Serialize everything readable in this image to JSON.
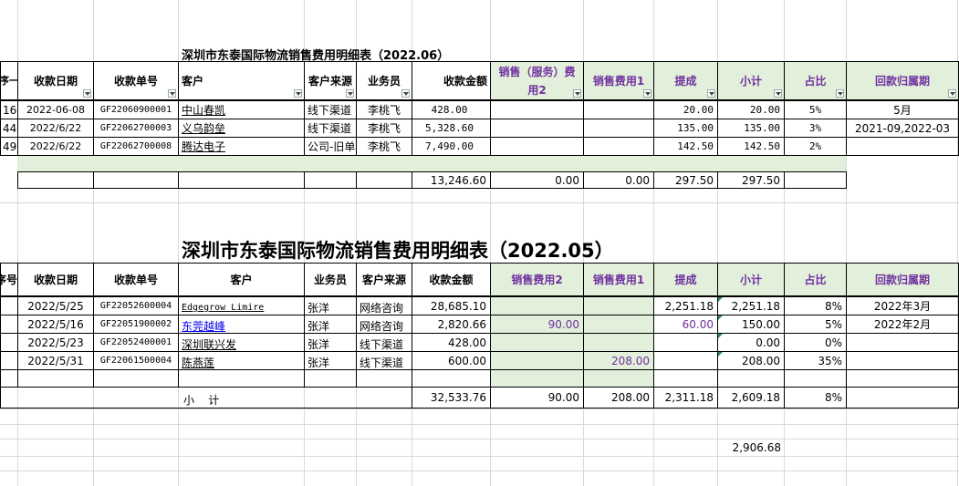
{
  "sheet1": {
    "title": "深圳市东泰国际物流销售费用明细表（2022.06）",
    "headers": {
      "seq": "序一",
      "date": "收款日期",
      "no": "收款单号",
      "customer": "客户",
      "source": "客户来源",
      "salesman": "业务员",
      "amount": "收款金额",
      "fee2_line1": "销售（服务）费",
      "fee2_line2": "用2",
      "fee1": "销售费用1",
      "commission": "提成",
      "subtotal": "小计",
      "ratio": "占比",
      "period": "回款归属期"
    },
    "rows": [
      {
        "seq": "16",
        "date": "2022-06-08",
        "no": "GF22060900001",
        "customer": "中山春凯",
        "source": "线下渠道",
        "salesman": "李桃飞",
        "amount": "428.00",
        "fee2": "",
        "fee1": "",
        "commission": "20.00",
        "subtotal": "20.00",
        "ratio": "5%",
        "period": "5月"
      },
      {
        "seq": "44",
        "date": "2022/6/22",
        "no": "GF22062700003",
        "customer": "义乌韵垒",
        "source": "线下渠道",
        "salesman": "李桃飞",
        "amount": "5,328.60",
        "fee2": "",
        "fee1": "",
        "commission": "135.00",
        "subtotal": "135.00",
        "ratio": "3%",
        "period": "2021-09,2022-03"
      },
      {
        "seq": "49",
        "date": "2022/6/22",
        "no": "GF22062700008",
        "customer": "腾达电子",
        "source": "公司-旧单",
        "salesman": "李桃飞",
        "amount": "7,490.00",
        "fee2": "",
        "fee1": "",
        "commission": "142.50",
        "subtotal": "142.50",
        "ratio": "2%",
        "period": ""
      }
    ],
    "totals": {
      "amount": "13,246.60",
      "fee2": "0.00",
      "fee1": "0.00",
      "commission": "297.50",
      "subtotal": "297.50"
    }
  },
  "sheet2": {
    "title": "深圳市东泰国际物流销售费用明细表（2022.05）",
    "headers": {
      "seq": "序号",
      "date": "收款日期",
      "no": "收款单号",
      "customer": "客户",
      "salesman": "业务员",
      "source": "客户来源",
      "amount": "收款金额",
      "fee2": "销售费用2",
      "fee1": "销售费用1",
      "commission": "提成",
      "subtotal": "小计",
      "ratio": "占比",
      "period": "回款归属期"
    },
    "rows": [
      {
        "date": "2022/5/25",
        "no": "GF22052600004",
        "customer": "Edgegrow Limire",
        "salesman": "张洋",
        "source": "网络咨询",
        "amount": "28,685.10",
        "fee2": "",
        "fee1": "",
        "commission": "2,251.18",
        "subtotal": "2,251.18",
        "ratio": "8%",
        "period": "2022年3月"
      },
      {
        "date": "2022/5/16",
        "no": "GF22051900002",
        "customer": "东莞越峰",
        "salesman": "张洋",
        "source": "网络咨询",
        "amount": "2,820.66",
        "fee2": "90.00",
        "fee1": "",
        "commission": "60.00",
        "subtotal": "150.00",
        "ratio": "5%",
        "period": "2022年2月"
      },
      {
        "date": "2022/5/23",
        "no": "GF22052400001",
        "customer": "深圳联兴发",
        "salesman": "张洋",
        "source": "线下渠道",
        "amount": "428.00",
        "fee2": "",
        "fee1": "",
        "commission": "",
        "subtotal": "0.00",
        "ratio": "0%",
        "period": ""
      },
      {
        "date": "2022/5/31",
        "no": "GF22061500004",
        "customer": "陈燕莲",
        "salesman": "张洋",
        "source": "线下渠道",
        "amount": "600.00",
        "fee2": "",
        "fee1": "208.00",
        "commission": "",
        "subtotal": "208.00",
        "ratio": "35%",
        "period": ""
      }
    ],
    "totals": {
      "label": "小    计",
      "amount": "32,533.76",
      "fee2": "90.00",
      "fee1": "208.00",
      "commission": "2,311.18",
      "subtotal": "2,609.18",
      "ratio": "8%"
    },
    "grand_total": "2,906.68"
  }
}
